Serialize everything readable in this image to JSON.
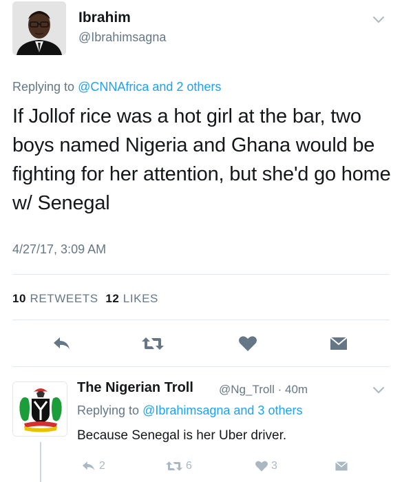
{
  "main_tweet": {
    "display_name": "Ibrahim",
    "handle": "@Ibrahimsagna",
    "replying_prefix": "Replying to ",
    "replying_to": "@CNNAfrica and 2 others",
    "text": "If Jollof rice was a hot girl at the bar, two boys named Nigeria and Ghana would be fighting for her attention, but she'd go home w/ Senegal",
    "timestamp": "4/27/17, 3:09 AM",
    "retweets_count": "10",
    "retweets_label": "RETWEETS",
    "likes_count": "12",
    "likes_label": "LIKES",
    "icons": [
      "reply-icon",
      "retweet-icon",
      "heart-icon",
      "message-icon",
      "chevron-down-icon"
    ]
  },
  "reply_tweet": {
    "display_name": "The Nigerian Troll",
    "handle": "@Ng_Troll",
    "separator": "·",
    "time_ago": "40m",
    "replying_prefix": "Replying to ",
    "replying_to": "@Ibrahimsagna and 3 others",
    "text": "Because Senegal is her Uber driver.",
    "reply_count": "2",
    "retweet_count": "6",
    "like_count": "3"
  },
  "colors": {
    "link": "#1da1f2",
    "secondary_text": "#657786",
    "primary_text": "#14171a",
    "action_icon": "#657786",
    "muted_icon": "#aab8c2",
    "divider": "#e1e8ed"
  }
}
